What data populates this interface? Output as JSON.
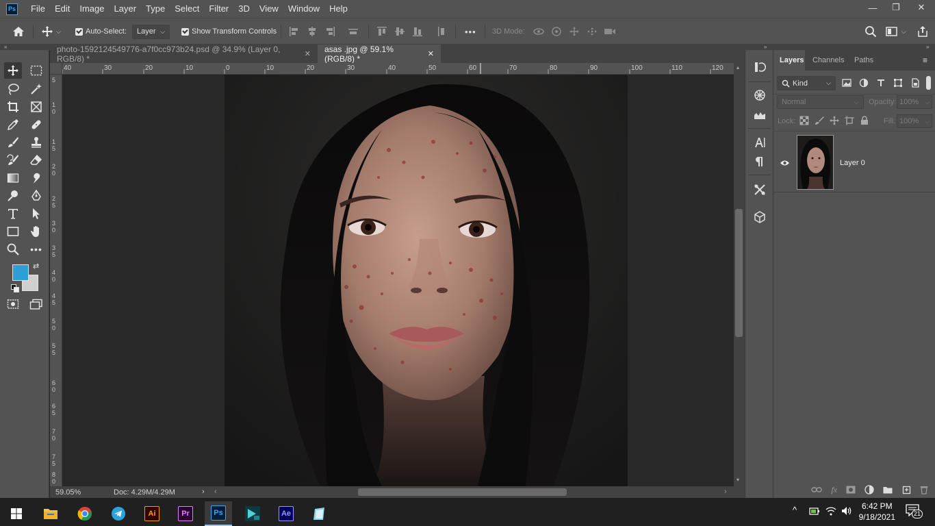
{
  "app": {
    "logo_text": "Ps"
  },
  "menu": [
    "File",
    "Edit",
    "Image",
    "Layer",
    "Type",
    "Select",
    "Filter",
    "3D",
    "View",
    "Window",
    "Help"
  ],
  "window_controls": {
    "minimize": "—",
    "restore": "❐",
    "close": "✕"
  },
  "options_bar": {
    "auto_select_label": "Auto-Select:",
    "auto_select_value": "Layer",
    "transform_label": "Show Transform Controls",
    "more": "•••",
    "mode_3d_label": "3D Mode:"
  },
  "tabs": [
    {
      "label": "photo-1592124549776-a7f0cc973b24.psd @ 34.9% (Layer 0, RGB/8) *",
      "close": "✕"
    },
    {
      "label": "asas .jpg @ 59.1% (RGB/8) *",
      "close": "✕"
    }
  ],
  "ruler_top_labels": [
    "40",
    "30",
    "20",
    "10",
    "0",
    "10",
    "20",
    "30",
    "40",
    "50",
    "60",
    "70",
    "80",
    "90",
    "100",
    "110",
    "120"
  ],
  "ruler_left_labels": [
    "5",
    "1\n0",
    "1\n5",
    "2\n0",
    "2\n5",
    "3\n0",
    "3\n5",
    "4\n0",
    "4\n5",
    "5\n0",
    "5\n5",
    "6\n0",
    "6\n5",
    "7\n0",
    "7\n5",
    "8\n0"
  ],
  "status": {
    "zoom": "59.05%",
    "doc": "Doc: 4.29M/4.29M"
  },
  "colors": {
    "foreground": "#2b9fd6",
    "background": "#d0d0d0",
    "ps_blue": "#31a8ff"
  },
  "layers_panel": {
    "tabs": [
      "Layers",
      "Channels",
      "Paths"
    ],
    "filter_kind": "Kind",
    "blend_mode": "Normal",
    "opacity_label": "Opacity:",
    "opacity_value": "100%",
    "lock_label": "Lock:",
    "fill_label": "Fill:",
    "fill_value": "100%",
    "layers": [
      {
        "name": "Layer 0",
        "visible": true
      }
    ]
  },
  "taskbar": {
    "apps": [
      "file-explorer",
      "chrome",
      "telegram",
      "illustrator",
      "premiere",
      "photoshop",
      "media-encoder",
      "after-effects",
      "notepad"
    ],
    "illustrator_label": "Ai",
    "premiere_label": "Pr",
    "photoshop_label": "Ps",
    "after_effects_label": "Ae",
    "time": "6:42 PM",
    "date": "9/18/2021",
    "notification_count": "21"
  }
}
